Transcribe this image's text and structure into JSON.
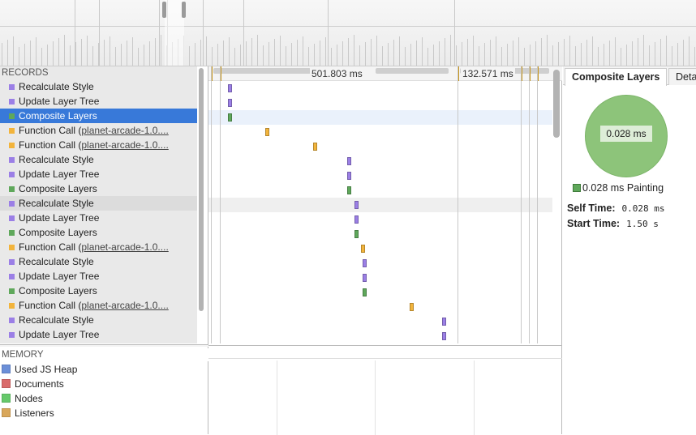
{
  "colors": {
    "rendering": "#9b7fe6",
    "scripting": "#f2b43c",
    "painting": "#5fa85b",
    "selection": "#3879d9",
    "used_js_heap": "#6b8fd8",
    "documents": "#d96b6b",
    "nodes": "#66c96b",
    "listeners": "#d9a75a"
  },
  "records": {
    "header": "RECORDS",
    "rows": [
      {
        "label": "Recalculate Style",
        "link": "",
        "category": "rendering",
        "state": ""
      },
      {
        "label": "Update Layer Tree",
        "link": "",
        "category": "rendering",
        "state": ""
      },
      {
        "label": "Composite Layers",
        "link": "",
        "category": "painting",
        "state": "selected"
      },
      {
        "label": "Function Call (",
        "link": "planet-arcade-1.0....",
        "category": "scripting",
        "state": ""
      },
      {
        "label": "Function Call (",
        "link": "planet-arcade-1.0....",
        "category": "scripting",
        "state": ""
      },
      {
        "label": "Recalculate Style",
        "link": "",
        "category": "rendering",
        "state": ""
      },
      {
        "label": "Update Layer Tree",
        "link": "",
        "category": "rendering",
        "state": ""
      },
      {
        "label": "Composite Layers",
        "link": "",
        "category": "painting",
        "state": ""
      },
      {
        "label": "Recalculate Style",
        "link": "",
        "category": "rendering",
        "state": "hovered"
      },
      {
        "label": "Update Layer Tree",
        "link": "",
        "category": "rendering",
        "state": ""
      },
      {
        "label": "Composite Layers",
        "link": "",
        "category": "painting",
        "state": ""
      },
      {
        "label": "Function Call (",
        "link": "planet-arcade-1.0....",
        "category": "scripting",
        "state": ""
      },
      {
        "label": "Recalculate Style",
        "link": "",
        "category": "rendering",
        "state": ""
      },
      {
        "label": "Update Layer Tree",
        "link": "",
        "category": "rendering",
        "state": ""
      },
      {
        "label": "Composite Layers",
        "link": "",
        "category": "painting",
        "state": ""
      },
      {
        "label": "Function Call (",
        "link": "planet-arcade-1.0....",
        "category": "scripting",
        "state": ""
      },
      {
        "label": "Recalculate Style",
        "link": "",
        "category": "rendering",
        "state": ""
      },
      {
        "label": "Update Layer Tree",
        "link": "",
        "category": "rendering",
        "state": ""
      }
    ]
  },
  "memory": {
    "header": "MEMORY",
    "items": [
      {
        "label": "Used JS Heap",
        "color": "used_js_heap"
      },
      {
        "label": "Documents",
        "color": "documents"
      },
      {
        "label": "Nodes",
        "color": "nodes"
      },
      {
        "label": "Listeners",
        "color": "listeners"
      }
    ]
  },
  "timeline": {
    "ruler_labels": [
      "501.803 ms",
      "132.571 ms"
    ]
  },
  "details": {
    "tabs": [
      "Composite Layers",
      "Details"
    ],
    "pie_value": "0.028 ms",
    "legend": "0.028 ms Painting",
    "self_time_label": "Self Time:",
    "self_time_value": "0.028 ms",
    "start_time_label": "Start Time:",
    "start_time_value": "1.50 s"
  }
}
